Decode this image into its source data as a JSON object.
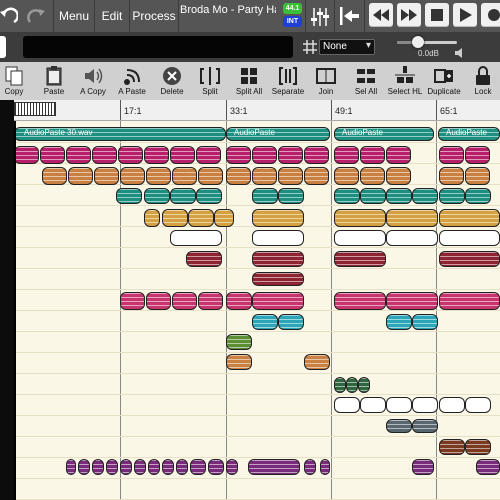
{
  "topbar": {
    "undo_icon": "undo-icon",
    "redo_icon": "redo-icon",
    "menu_label": "Menu",
    "edit_label": "Edit",
    "process_label": "Process",
    "song_title": "Broda Mo - Party Haa",
    "sample_rate": "44.1",
    "sync_mode": "INT",
    "colors": {
      "rate_badge": "#3bbf3b",
      "int_badge": "#1f3fd6"
    }
  },
  "secondbar": {
    "snap_value": "None",
    "volume_readout": "0.0dB",
    "volume_level": 0.35
  },
  "toolbar": {
    "items": [
      {
        "label": "Copy",
        "icon": "copy-icon"
      },
      {
        "label": "Paste",
        "icon": "paste-icon"
      },
      {
        "label": "A Copy",
        "icon": "speaker-icon"
      },
      {
        "label": "A Paste",
        "icon": "antenna-icon"
      },
      {
        "label": "Delete",
        "icon": "delete-icon"
      },
      {
        "label": "Split",
        "icon": "split-icon"
      },
      {
        "label": "Split All",
        "icon": "split-all-icon"
      },
      {
        "label": "Separate",
        "icon": "separate-icon"
      },
      {
        "label": "Join",
        "icon": "join-icon"
      },
      {
        "label": "Sel All",
        "icon": "select-all-icon"
      },
      {
        "label": "Select HL",
        "icon": "select-hl-icon"
      },
      {
        "label": "Duplicate",
        "icon": "duplicate-icon"
      },
      {
        "label": "Lock",
        "icon": "lock-icon"
      }
    ]
  },
  "ruler": {
    "labels": [
      "17:1",
      "33:1",
      "49:1",
      "65:1"
    ]
  },
  "clips": {
    "top_clip_titles": [
      "AudioPaste 30.wav",
      "AudioPaste",
      "AudioPaste",
      "AudioPaste"
    ],
    "colors": {
      "teal": "#1d8f80",
      "magenta": "#b81f6a",
      "orange": "#c98040",
      "gold": "#d4a040",
      "white": "#ffffff",
      "darkred": "#8e2332",
      "pink": "#c8356e",
      "cyan": "#2aa6b8",
      "green": "#5c8f33",
      "darkgreen": "#2f6640",
      "grey": "#586670",
      "brown": "#7a3a20",
      "purple": "#7a2a7a"
    }
  }
}
